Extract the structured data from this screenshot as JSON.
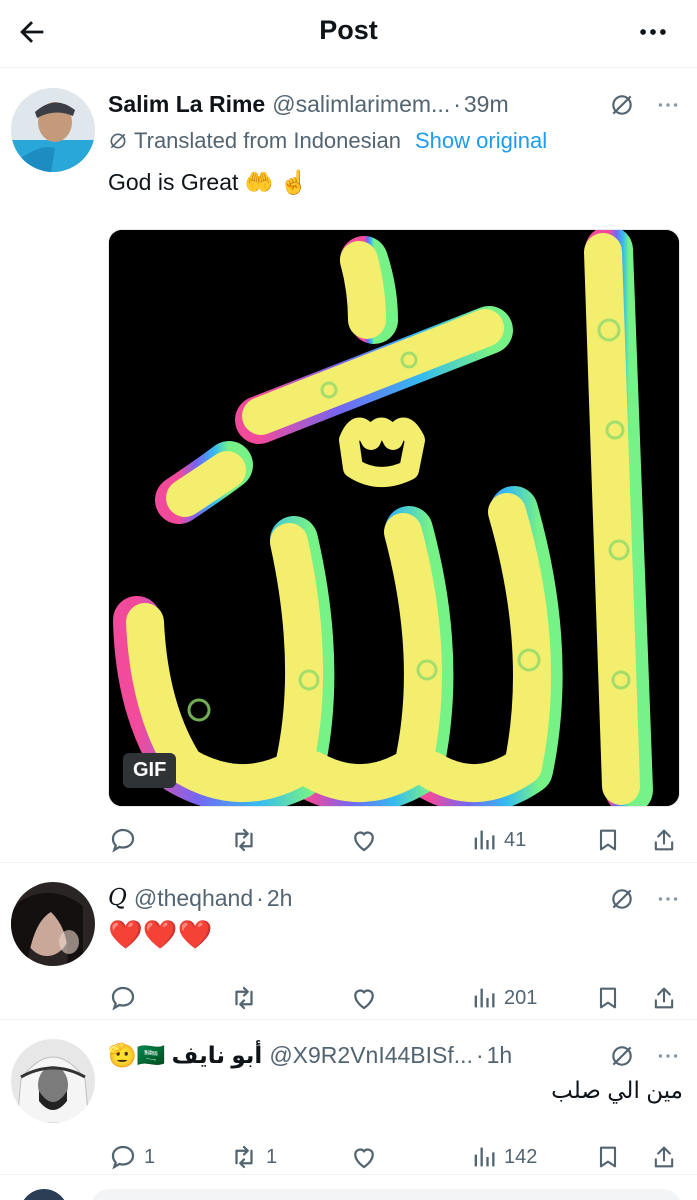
{
  "header": {
    "title": "Post"
  },
  "main_post": {
    "name": "Salim La Rime",
    "handle": "@salimlarimem...",
    "time": "39m",
    "translated_label": "Translated from Indonesian",
    "show_original": "Show original",
    "text": "God is Great 🤲 ☝️",
    "gif_badge": "GIF",
    "views": "41"
  },
  "replies": [
    {
      "name": "Q",
      "handle": "@theqhand",
      "time": "2h",
      "text": "❤️❤️❤️",
      "replies_count": "",
      "reposts_count": "",
      "views": "201"
    },
    {
      "name": "🫡🇸🇦 أبو نايف",
      "handle": "@X9R2VnI44BISf...",
      "time": "1h",
      "text": "مين الي صلب",
      "replies_count": "1",
      "reposts_count": "1",
      "views": "142"
    }
  ],
  "colors": {
    "text": "#0f1419",
    "secondary": "#536471",
    "link": "#1d9bf0",
    "divider": "#eff3f4"
  },
  "icons": [
    "back-arrow-icon",
    "more-icon",
    "grok-slash-icon",
    "reply-icon",
    "repost-icon",
    "like-icon",
    "views-icon",
    "bookmark-icon",
    "share-icon"
  ]
}
